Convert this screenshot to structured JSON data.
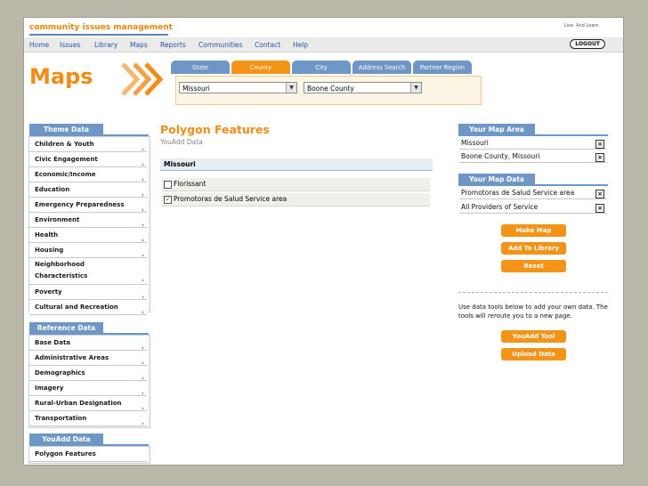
{
  "brand": "community issues management",
  "tagline": "Live. And Learn.",
  "nav": [
    "Home",
    "Issues",
    "Library",
    "Maps",
    "Reports",
    "Communities",
    "Contact",
    "Help"
  ],
  "logout": "LOGOUT",
  "page_title": "Maps",
  "tabs": [
    "State",
    "County",
    "City",
    "Address Search",
    "Partner Region"
  ],
  "active_tab": "County",
  "selects": {
    "state_value": "Missouri",
    "county_value": "Boone County"
  },
  "theme_data": {
    "title": "Theme Data",
    "items": [
      "Children & Youth",
      "Civic Engagement",
      "Economic/Income",
      "Education",
      "Emergency Preparedness",
      "Environment",
      "Health",
      "Housing",
      "Neighborhood Characteristics",
      "Poverty",
      "Cultural and Recreation"
    ]
  },
  "reference_data": {
    "title": "Reference Data",
    "items": [
      "Base Data",
      "Administrative Areas",
      "Demographics",
      "Imagery",
      "Rural-Urban Designation",
      "Transportation"
    ]
  },
  "youadd_data": {
    "title": "YouAdd Data",
    "items": [
      "Polygon Features"
    ]
  },
  "main": {
    "title": "Polygon Features",
    "subtitle": "YouAdd Data",
    "group": "Missouri",
    "features": [
      {
        "label": "Florissant",
        "checked": false
      },
      {
        "label": "Promotoras de Salud Service area",
        "checked": true
      }
    ]
  },
  "map_area": {
    "title": "Your Map Area",
    "items": [
      "Missouri",
      "Boone County, Missouri"
    ]
  },
  "map_data": {
    "title": "Your Map Data",
    "items": [
      "Promotoras de Salud Service area",
      "All Providers of Service"
    ]
  },
  "buttons": {
    "make_map": "Make Map",
    "add_to_library": "Add To Library",
    "reset": "Reset",
    "youadd_tool": "YouAdd Tool",
    "upload_data": "Upload Data"
  },
  "tools_note": "Use data tools below to add your own data. The tools will reroute you to a new page.",
  "colors": {
    "accent_orange": "#f39419",
    "nav_blue": "#6e97c5",
    "link_blue": "#27519b"
  },
  "icons": {
    "remove": "close-box-icon",
    "submenu": "chevron-right-icon",
    "dropdown": "chevron-down-icon",
    "checkbox": "checkbox-icon"
  }
}
